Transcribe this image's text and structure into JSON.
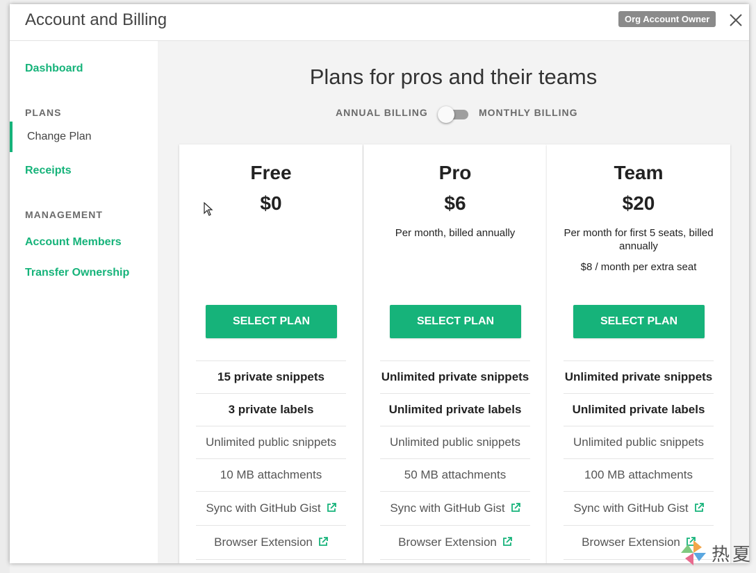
{
  "header": {
    "title": "Account and Billing",
    "badge": "Org Account Owner",
    "close_icon": "close-icon"
  },
  "sidebar": {
    "dashboard": "Dashboard",
    "plans_section": "PLANS",
    "change_plan": "Change Plan",
    "receipts": "Receipts",
    "management_section": "MANAGEMENT",
    "account_members": "Account Members",
    "transfer_ownership": "Transfer Ownership"
  },
  "main": {
    "title": "Plans for pros and their teams",
    "annual_label": "ANNUAL BILLING",
    "monthly_label": "MONTHLY BILLING",
    "toggle_on": false
  },
  "plans": [
    {
      "name": "Free",
      "price": "$0",
      "desc": "",
      "extra": "",
      "button": "SELECT PLAN",
      "features": [
        "15 private snippets",
        "3 private labels",
        "Unlimited public snippets",
        "10 MB attachments",
        "Sync with GitHub Gist",
        "Browser Extension"
      ]
    },
    {
      "name": "Pro",
      "price": "$6",
      "desc": "Per month, billed annually",
      "extra": "",
      "button": "SELECT PLAN",
      "features": [
        "Unlimited private snippets",
        "Unlimited private labels",
        "Unlimited public snippets",
        "50 MB attachments",
        "Sync with GitHub Gist",
        "Browser Extension"
      ]
    },
    {
      "name": "Team",
      "price": "$20",
      "desc": "Per month for first 5 seats, billed annually",
      "extra": "$8 / month per extra seat",
      "button": "SELECT PLAN",
      "features": [
        "Unlimited private snippets",
        "Unlimited private labels",
        "Unlimited public snippets",
        "100 MB attachments",
        "Sync with GitHub Gist",
        "Browser Extension"
      ]
    }
  ],
  "colors": {
    "accent": "#16b37a",
    "badge": "#8a8a8a"
  },
  "watermark": {
    "text": "热夏"
  }
}
